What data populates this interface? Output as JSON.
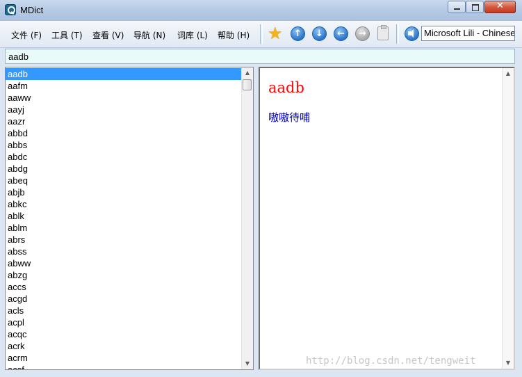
{
  "window": {
    "title": "MDict",
    "close_glyph": "✕"
  },
  "menu": {
    "items": [
      {
        "label": "文件 (F)"
      },
      {
        "label": "工具 (T)"
      },
      {
        "label": "查看 (V)"
      },
      {
        "label": "导航 (N)"
      },
      {
        "label": "词库 (L)"
      },
      {
        "label": "帮助 (H)"
      }
    ]
  },
  "toolbar": {
    "icons": [
      "star-icon",
      "arrow-up-icon",
      "arrow-down-icon",
      "arrow-left-icon",
      "arrow-right-icon",
      "clipboard-icon",
      "speaker-icon"
    ],
    "glyphs": {
      "star": "★",
      "up": "↑",
      "down": "↓",
      "back": "←",
      "forward": "→"
    },
    "voice_select": "Microsoft Lili - Chinese",
    "accent_color": "#2a75c9",
    "star_color": "#f2b31c"
  },
  "search": {
    "value": "aadb"
  },
  "word_list": {
    "selected_index": 0,
    "selected_color": "#3399ff",
    "items": [
      "aadb",
      "aafm",
      "aaww",
      "aayj",
      "aazr",
      "abbd",
      "abbs",
      "abdc",
      "abdg",
      "abeq",
      "abjb",
      "abkc",
      "ablk",
      "ablm",
      "abrs",
      "abss",
      "abww",
      "abzg",
      "accs",
      "acgd",
      "acls",
      "acpl",
      "acqc",
      "acrk",
      "acrm",
      "acsf"
    ]
  },
  "definition": {
    "headword": "aadb",
    "headword_color": "#ff0000",
    "text": "嗷嗷待哺",
    "text_color": "#0000c0"
  },
  "watermark": "http://blog.csdn.net/tengweit"
}
